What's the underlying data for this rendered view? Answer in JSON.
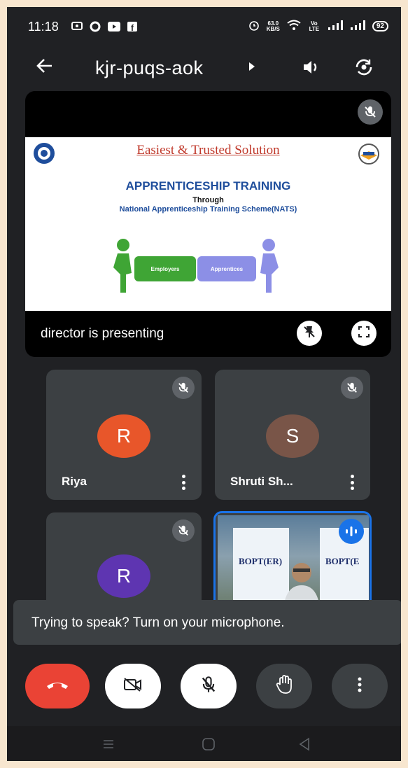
{
  "status_bar": {
    "time": "11:18",
    "net_speed_top": "63.0",
    "net_speed_bottom": "KB/S",
    "volte": "Vo LTE",
    "battery": "92"
  },
  "header": {
    "meeting_code": "kjr-puqs-aok",
    "back_icon": "arrow-left-icon",
    "speaker_icon": "speaker-icon",
    "switch_camera_icon": "switch-camera-icon"
  },
  "presentation": {
    "slide": {
      "headline": "Easiest & Trusted Solution",
      "title": "APPRENTICESHIP TRAINING",
      "through": "Through",
      "scheme": "National Apprenticeship Training Scheme(NATS)",
      "puzzle_left": "Employers",
      "puzzle_right": "Apprentices"
    },
    "presenter_text": "director is presenting"
  },
  "participants": [
    {
      "name": "Riya",
      "initial": "R",
      "avatar_color": "#e8562a"
    },
    {
      "name": "Shruti Sh...",
      "initial": "S",
      "avatar_color": "#795548"
    },
    {
      "name": "",
      "initial": "R",
      "avatar_color": "#5e35b1"
    }
  ],
  "video_tile": {
    "banner_left": "BOPT(ER)",
    "banner_right": "BOPT(E"
  },
  "snackbar": {
    "message": "Trying to speak? Turn on your microphone."
  },
  "colors": {
    "end_call": "#ea4335",
    "speaking": "#1a73e8",
    "background": "#202124",
    "tile": "#3c4043"
  }
}
